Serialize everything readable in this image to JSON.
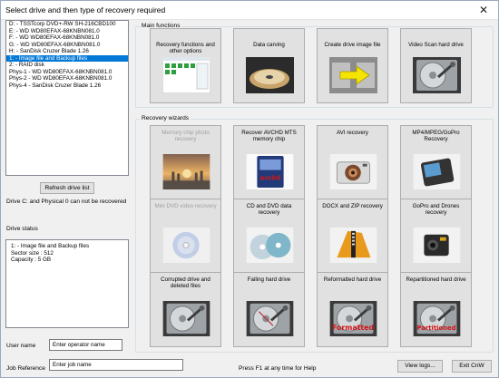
{
  "window": {
    "title": "Select drive and then type of recovery required",
    "close_glyph": "✕"
  },
  "drives": [
    {
      "label": "D: - TSSTcorp DVD+-RW SH-216CBD100",
      "selected": false
    },
    {
      "label": "E: - WD       WD80EFAX-68KNBN081.0",
      "selected": false
    },
    {
      "label": "F: - WD       WD80EFAX-68KNBN081.0",
      "selected": false
    },
    {
      "label": "G: - WD       WD80EFAX-68KNBN081.0",
      "selected": false
    },
    {
      "label": "H: - SanDisk  Cruzer Blade     1.26",
      "selected": false
    },
    {
      "label": "1: - Image file and Backup files",
      "selected": true
    },
    {
      "label": "2: - RAID disk",
      "selected": false
    },
    {
      "label": "Phys-1 - WD      WD80EFAX-68KNBN081.0",
      "selected": false
    },
    {
      "label": "Phys-2 - WD      WD80EFAX-68KNBN081.0",
      "selected": false
    },
    {
      "label": "Phys-4 - SanDisk  Cruzer Blade     1.26",
      "selected": false
    }
  ],
  "refresh_button": "Refresh drive list",
  "drive_note": "Drive C: and Physical 0 can not be recovered",
  "drive_status": {
    "label": "Drive status",
    "lines": [
      "1: - Image file and Backup files",
      "Sector size : 512",
      "Capacity    : 5 GB"
    ]
  },
  "user_name": {
    "label": "User name",
    "placeholder": "Enter operator name"
  },
  "job_reference": {
    "label": "Job Reference",
    "placeholder": "Enter job name"
  },
  "help_text": "Press F1 at any time for Help",
  "view_logs_button": "View logs...",
  "exit_button": "Exit CnW",
  "main_functions": {
    "title": "Main functions",
    "tiles": [
      {
        "label": "Recovery functions and other options",
        "icon": "app-screenshot-icon",
        "enabled": true
      },
      {
        "label": "Data carving",
        "icon": "disk-platter-icon",
        "enabled": true
      },
      {
        "label": "Create drive image file",
        "icon": "copy-arrow-icon",
        "enabled": true
      },
      {
        "label": "Video Scan hard drive",
        "icon": "hard-drive-icon",
        "enabled": true
      }
    ]
  },
  "recovery_wizards": {
    "title": "Recovery wizards",
    "tiles": [
      {
        "label": "Memory chip photo recovery",
        "icon": "sunset-photo-icon",
        "enabled": false
      },
      {
        "label": "Recover AVCHD MTS memory chip",
        "icon": "memory-card-icon",
        "enabled": true
      },
      {
        "label": "AVI recovery",
        "icon": "camera-icon",
        "enabled": true
      },
      {
        "label": "MP4/MPEG/GoPro Recovery",
        "icon": "phone-icon",
        "enabled": true
      },
      {
        "label": "Mini DVD video recovery",
        "icon": "mini-dvd-icon",
        "enabled": false
      },
      {
        "label": "CD and DVD data recovery",
        "icon": "cd-dvd-icon",
        "enabled": true
      },
      {
        "label": "DOCX and ZIP recovery",
        "icon": "zip-file-icon",
        "enabled": true
      },
      {
        "label": "GoPro and Drones recovery",
        "icon": "gopro-icon",
        "enabled": true
      },
      {
        "label": "Corrupted drive and deleted files",
        "icon": "corrupted-drive-icon",
        "enabled": true
      },
      {
        "label": "Failing hard drive",
        "icon": "failing-drive-icon",
        "enabled": true
      },
      {
        "label": "Reformatted hard drive",
        "icon": "reformatted-drive-icon",
        "enabled": true
      },
      {
        "label": "Repartitioned hard drive",
        "icon": "repartitioned-drive-icon",
        "enabled": true
      }
    ]
  },
  "image_text": {
    "avchd": "avchd",
    "formatted": "Formatted",
    "partitioned": "Partitioned"
  },
  "colors": {
    "selection": "#0078d7",
    "stamp_red": "#d41515",
    "arrow_yellow": "#f5e400"
  }
}
